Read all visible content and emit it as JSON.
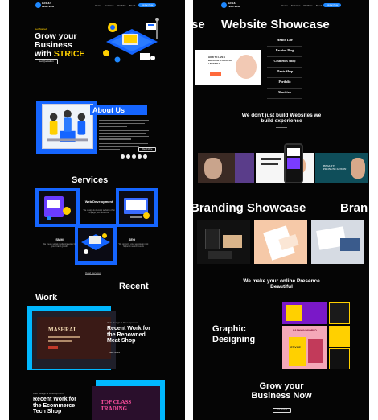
{
  "brand": {
    "logo_text": "HASHU\nLEGITECH",
    "accent": "#1565ff",
    "highlight": "#ffd000"
  },
  "left": {
    "nav": {
      "links": [
        "Home",
        "Services",
        "Portfolio",
        "About"
      ],
      "cta": "Contact Now"
    },
    "hero": {
      "tagline": "Get Started",
      "title_line1": "Grow your",
      "title_line2": "Business",
      "title_line3_prefix": "with ",
      "title_highlight": "STRICE",
      "button": "Get Quotation"
    },
    "about": {
      "title": "About Us",
      "button": "Read More"
    },
    "services": {
      "title": "Services",
      "items": [
        {
          "name": "Web Development",
          "desc": "We design & develop websites that engage your audience"
        },
        {
          "name": "SMM",
          "desc": "We create social media strategies for your brand growth"
        },
        {
          "name": "SEO",
          "desc": "We optimize your website to rank higher in search results"
        }
      ],
      "button": "Read Services"
    },
    "recent_work": {
      "title_a": "Recent",
      "title_b": "Work",
      "item1": {
        "kicker": "Web Design & Development",
        "title": "Recent Work for the Renowned Meat Shop",
        "card_text": "MASHRAI",
        "button": "View More"
      },
      "item2": {
        "kicker": "Web Design & Development",
        "title": "Recent Work for the Ecommerce Tech Shop",
        "card_text": "TOP CLASS TRADING"
      }
    }
  },
  "right": {
    "nav": {
      "links": [
        "Home",
        "Services",
        "Portfolio",
        "About"
      ],
      "cta": "Contact Now"
    },
    "website_showcase": {
      "title_pre": "se",
      "title": "Website Showcase",
      "categories": [
        "Health Life",
        "Fashion Blog",
        "Cosmetics Shop",
        "Plants Shop",
        "Portfolio",
        "Musician"
      ],
      "card_text": "HOW TO LIVE A BREATHE A HEALTHY LIFESTYLE"
    },
    "experience": {
      "title_line1": "We don't just build Websites we",
      "title_line2": "build experience",
      "card_text": "BEAUTY PRONUNCIATION"
    },
    "branding": {
      "title_pre": "Branding Showcase",
      "title_post": "Bran"
    },
    "presence": {
      "title_line1": "We make your online Presence",
      "title_line2": "Beautiful"
    },
    "graphic": {
      "title_line1": "Graphic",
      "title_line2": "Designing",
      "poster1": "FASHION WORLD",
      "poster2": "STYLE"
    },
    "grow": {
      "title_line1": "Grow your",
      "title_line2": "Business Now",
      "button": "Get Started"
    }
  }
}
